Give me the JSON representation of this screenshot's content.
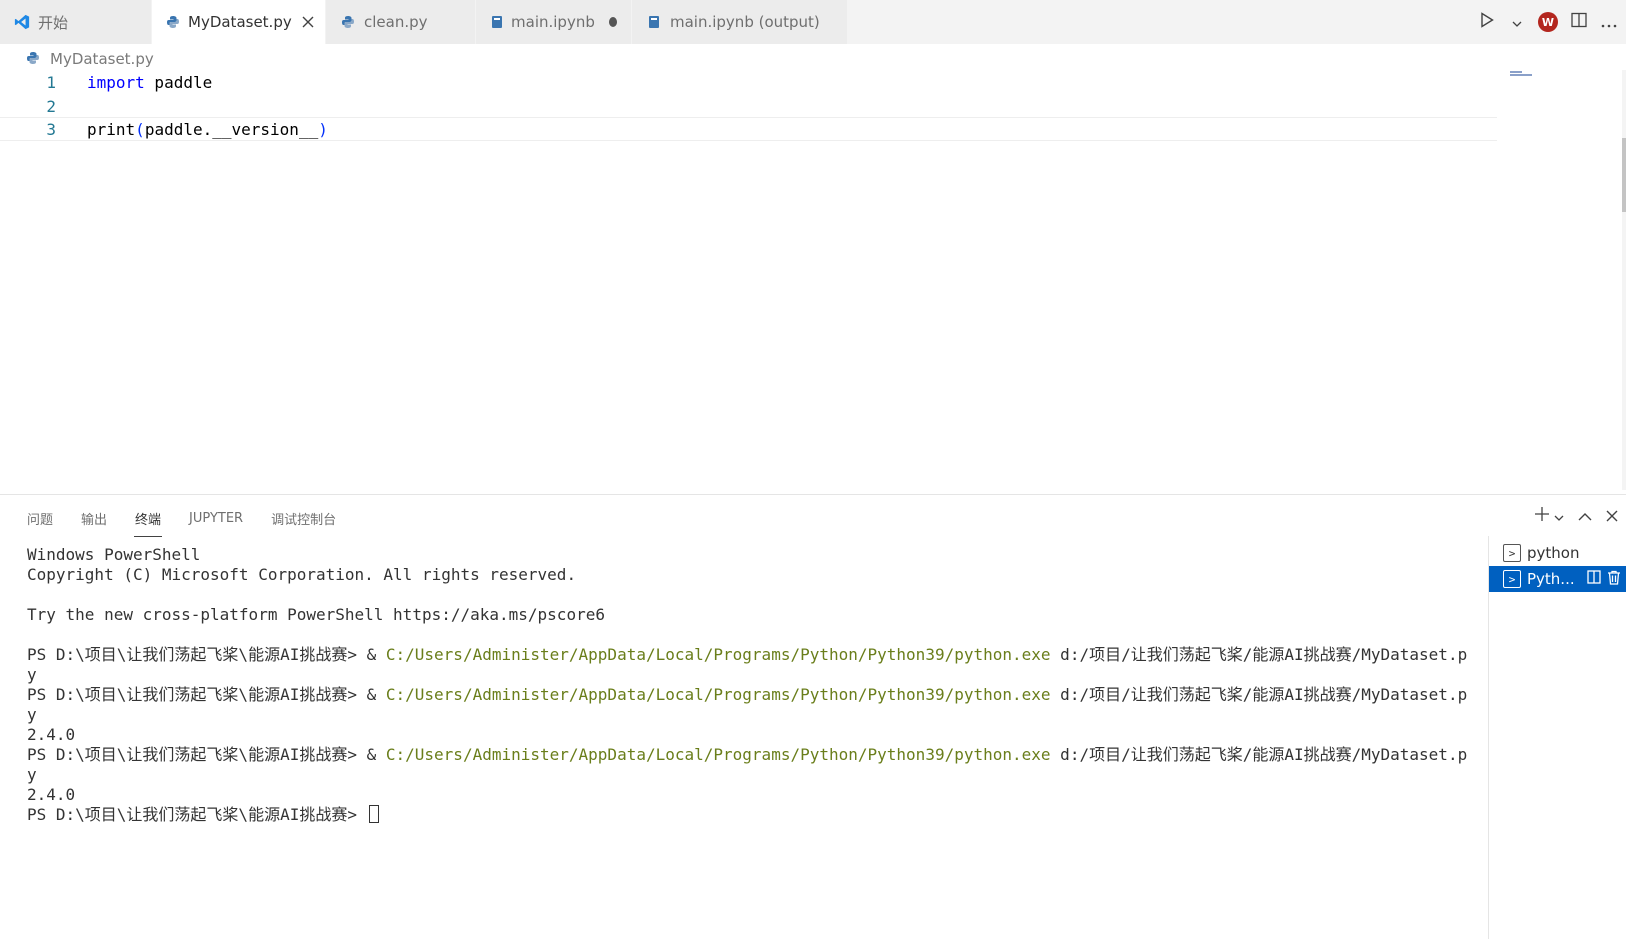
{
  "tabs": [
    {
      "label": "开始"
    },
    {
      "label": "MyDataset.py"
    },
    {
      "label": "clean.py"
    },
    {
      "label": "main.ipynb"
    },
    {
      "label": "main.ipynb (output)"
    }
  ],
  "tabbar_actions": {
    "run_icon": "play-icon",
    "account_badge": "W"
  },
  "breadcrumb": {
    "file": "MyDataset.py"
  },
  "editor": {
    "lines": [
      {
        "number": "1",
        "keyword": "import",
        "rest": " paddle"
      },
      {
        "number": "2",
        "text": ""
      },
      {
        "number": "3",
        "func": "print",
        "open": "(",
        "arg": "paddle.__version__",
        "close": ")"
      }
    ]
  },
  "panel": {
    "tabs": [
      "问题",
      "输出",
      "终端",
      "JUPYTER",
      "调试控制台"
    ],
    "active_tab": "终端"
  },
  "terminal": {
    "line1": "Windows PowerShell",
    "line2": "Copyright (C) Microsoft Corporation. All rights reserved.",
    "line3": "Try the new cross-platform PowerShell https://aka.ms/pscore6",
    "prompt": "PS D:\\项目\\让我们荡起飞桨\\能源AI挑战赛> & ",
    "exe": "C:/Users/Administer/AppData/Local/Programs/Python/Python39/python.exe",
    "script": " d:/项目/让我们荡起飞桨/能源AI挑战赛/MyDataset.p",
    "wrap": "y",
    "output": "2.4.0",
    "final_prompt": "PS D:\\项目\\让我们荡起飞桨\\能源AI挑战赛> "
  },
  "terminal_list": [
    {
      "label": "python"
    },
    {
      "label": "Pyth..."
    }
  ],
  "colors": {
    "accent": "#0060c0",
    "keyword": "#0000ff",
    "line_number": "#237893",
    "path": "#6a7e1b"
  }
}
